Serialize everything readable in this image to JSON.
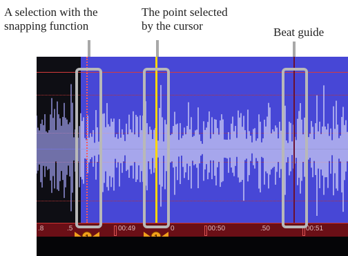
{
  "callouts": {
    "snap_selection": {
      "line1": "A selection with the",
      "line2": "snapping function"
    },
    "cursor_point": {
      "line1": "The point selected",
      "line2": "by the cursor"
    },
    "beat_guide": {
      "line1": "Beat guide"
    }
  },
  "ruler": {
    "labels": [
      ".8",
      ".5",
      "00:49",
      "0",
      "00:50",
      ".50",
      "00:51"
    ]
  },
  "colors": {
    "selection": "#4747d6",
    "waveform": "#c9c9f4",
    "cursor": "#ffd700",
    "beat_guide": "#6a1030",
    "ruler": "#6a0f16",
    "marker": "#f2a01a"
  }
}
